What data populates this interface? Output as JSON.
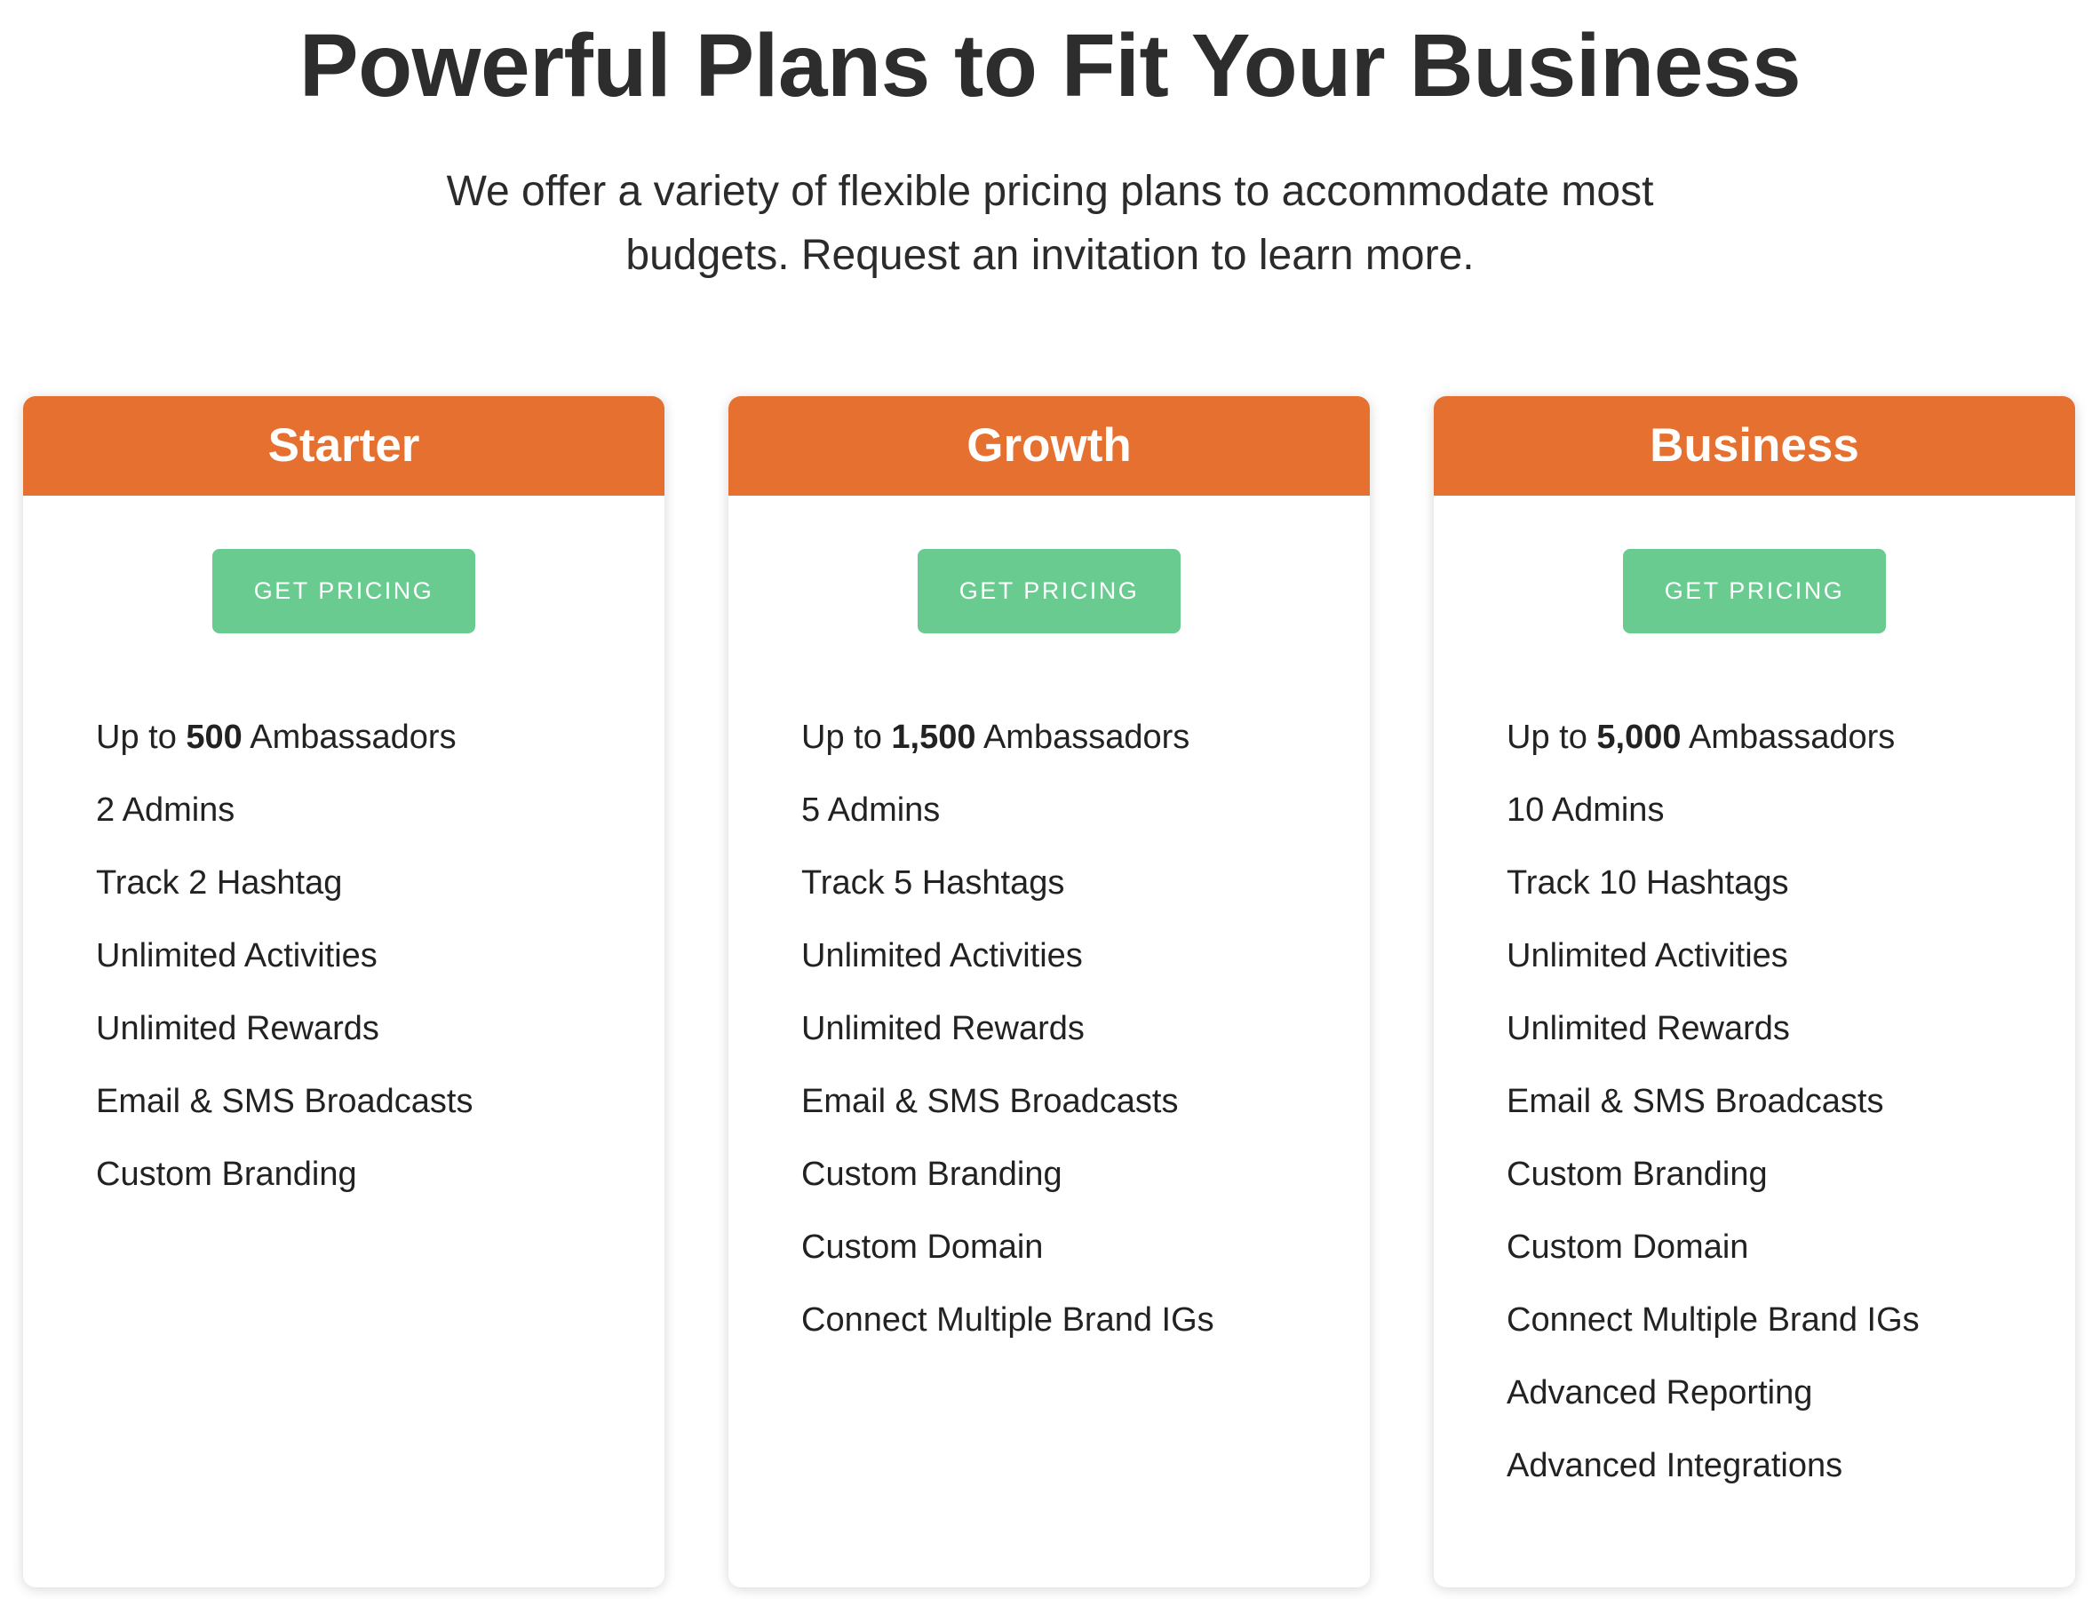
{
  "header": {
    "title": "Powerful Plans to Fit Your Business",
    "subtitle": "We offer a variety of flexible pricing plans to accommodate most budgets. Request an invitation to learn more."
  },
  "colors": {
    "header_orange": "#e5702f",
    "button_green": "#69cb8f",
    "text_dark": "#2d2d2d"
  },
  "plans": [
    {
      "name": "Starter",
      "button_label": "GET PRICING",
      "ambassadors": {
        "prefix": "Up to ",
        "count": "500",
        "suffix": " Ambassadors"
      },
      "features": [
        "2 Admins",
        "Track 2 Hashtag",
        "Unlimited Activities",
        "Unlimited Rewards",
        "Email & SMS Broadcasts",
        "Custom Branding"
      ]
    },
    {
      "name": "Growth",
      "button_label": "GET PRICING",
      "ambassadors": {
        "prefix": "Up to ",
        "count": "1,500",
        "suffix": " Ambassadors"
      },
      "features": [
        "5 Admins",
        "Track 5 Hashtags",
        "Unlimited Activities",
        "Unlimited Rewards",
        "Email & SMS Broadcasts",
        "Custom Branding",
        "Custom Domain",
        "Connect Multiple Brand IGs"
      ]
    },
    {
      "name": "Business",
      "button_label": "GET PRICING",
      "ambassadors": {
        "prefix": "Up to ",
        "count": "5,000",
        "suffix": " Ambassadors"
      },
      "features": [
        "10 Admins",
        "Track 10 Hashtags",
        "Unlimited Activities",
        "Unlimited Rewards",
        "Email & SMS Broadcasts",
        "Custom Branding",
        "Custom Domain",
        "Connect Multiple Brand IGs",
        "Advanced Reporting",
        "Advanced Integrations"
      ]
    }
  ]
}
